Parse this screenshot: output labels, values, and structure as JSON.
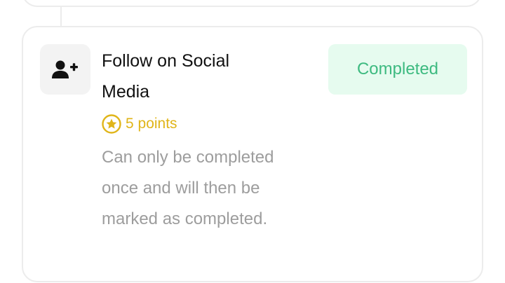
{
  "task": {
    "title": "Follow on Social Media",
    "points_label": "5 points",
    "description": "Can only be completed once and will then be marked as completed.",
    "status_label": "Completed",
    "icon": "add-user-icon",
    "points_icon": "star-coin-icon"
  },
  "colors": {
    "status_text": "#3dba80",
    "status_bg": "#e6fbef",
    "points": "#e0b519",
    "description": "#9d9d9d"
  }
}
